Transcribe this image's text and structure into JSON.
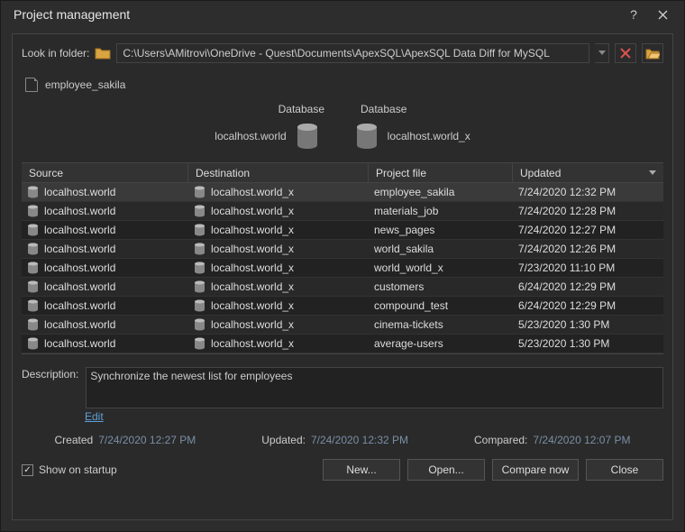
{
  "window": {
    "title": "Project management"
  },
  "folder": {
    "label": "Look in folder:",
    "path": "C:\\Users\\AMitrovi\\OneDrive - Quest\\Documents\\ApexSQL\\ApexSQL Data Diff for MySQL"
  },
  "current_file": "employee_sakila",
  "preview": {
    "left_label": "Database",
    "right_label": "Database",
    "left_db": "localhost.world",
    "right_db": "localhost.world_x"
  },
  "grid": {
    "headers": {
      "source": "Source",
      "destination": "Destination",
      "project_file": "Project file",
      "updated": "Updated"
    },
    "rows": [
      {
        "source": "localhost.world",
        "destination": "localhost.world_x",
        "project_file": "employee_sakila",
        "updated": "7/24/2020 12:32 PM",
        "selected": true
      },
      {
        "source": "localhost.world",
        "destination": "localhost.world_x",
        "project_file": "materials_job",
        "updated": "7/24/2020 12:28 PM"
      },
      {
        "source": "localhost.world",
        "destination": "localhost.world_x",
        "project_file": "news_pages",
        "updated": "7/24/2020 12:27 PM"
      },
      {
        "source": "localhost.world",
        "destination": "localhost.world_x",
        "project_file": "world_sakila",
        "updated": "7/24/2020 12:26 PM"
      },
      {
        "source": "localhost.world",
        "destination": "localhost.world_x",
        "project_file": "world_world_x",
        "updated": "7/23/2020 11:10 PM"
      },
      {
        "source": "localhost.world",
        "destination": "localhost.world_x",
        "project_file": "customers",
        "updated": "6/24/2020 12:29 PM"
      },
      {
        "source": "localhost.world",
        "destination": "localhost.world_x",
        "project_file": "compound_test",
        "updated": "6/24/2020 12:29 PM"
      },
      {
        "source": "localhost.world",
        "destination": "localhost.world_x",
        "project_file": "cinema-tickets",
        "updated": "5/23/2020 1:30 PM"
      },
      {
        "source": "localhost.world",
        "destination": "localhost.world_x",
        "project_file": "average-users",
        "updated": "5/23/2020 1:30 PM"
      }
    ]
  },
  "description": {
    "label": "Description:",
    "text": "Synchronize the newest list for employees",
    "edit": "Edit"
  },
  "meta": {
    "created_label": "Created",
    "created_value": "7/24/2020 12:27 PM",
    "updated_label": "Updated:",
    "updated_value": "7/24/2020 12:32 PM",
    "compared_label": "Compared:",
    "compared_value": "7/24/2020 12:07 PM"
  },
  "footer": {
    "show_on_startup": "Show on startup",
    "new": "New...",
    "open": "Open...",
    "compare": "Compare now",
    "close": "Close"
  }
}
